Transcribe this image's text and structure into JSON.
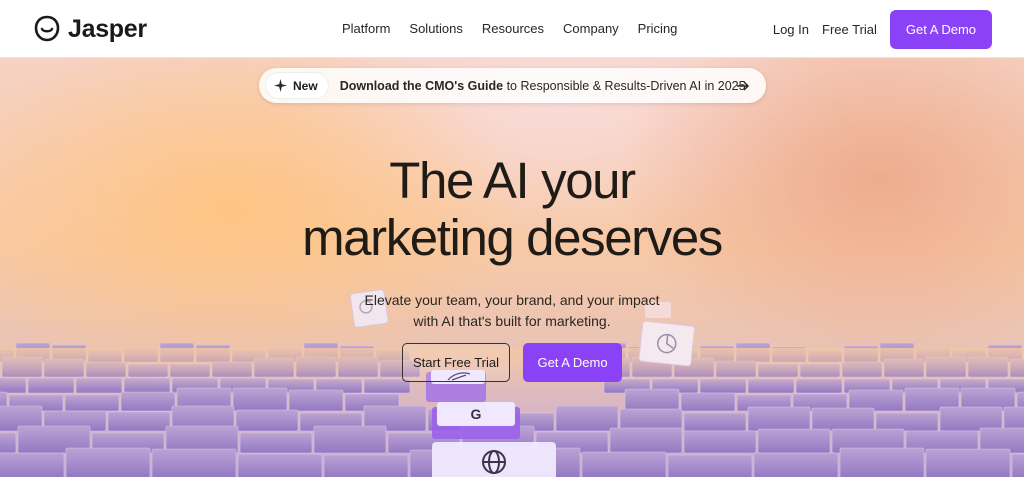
{
  "brand": {
    "name": "Jasper",
    "logo_icon": "jasper-face-icon",
    "accent": "#8b41f5"
  },
  "nav": {
    "links": [
      "Platform",
      "Solutions",
      "Resources",
      "Company",
      "Pricing"
    ],
    "login": "Log In",
    "free_trial": "Free Trial",
    "demo": "Get A Demo"
  },
  "announcement": {
    "badge": "New",
    "badge_icon": "sparkle-icon",
    "bold": "Download the CMO's Guide",
    "rest": " to Responsible & Results-Driven AI in 2025",
    "arrow_icon": "arrow-right-icon"
  },
  "hero": {
    "headline_line1": "The AI your",
    "headline_line2": "marketing deserves",
    "sub_line1": "Elevate your team, your brand, and your impact",
    "sub_line2": "with AI that's built for marketing.",
    "cta_trial": "Start Free Trial",
    "cta_demo": "Get A Demo"
  }
}
